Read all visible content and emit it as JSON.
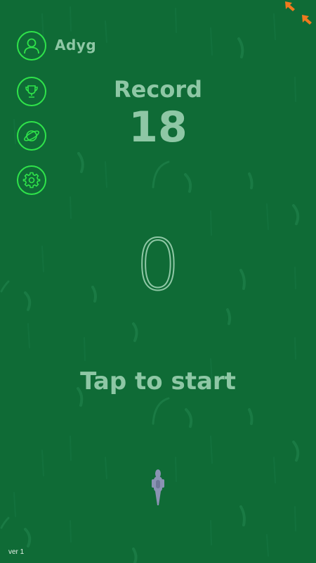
{
  "player": {
    "name": "Adyg"
  },
  "record": {
    "label": "Record",
    "value": "18"
  },
  "score": {
    "current": "0"
  },
  "prompt": {
    "tap_to_start": "Tap to start"
  },
  "footer": {
    "version": "ver 1"
  },
  "menu": {
    "icons": [
      "user-icon",
      "trophy-icon",
      "planet-icon",
      "gear-icon"
    ]
  },
  "colors": {
    "background": "#0f6b36",
    "accent": "#2fe34a",
    "text": "#8ec7a5",
    "arrow": "#f07a1e"
  }
}
